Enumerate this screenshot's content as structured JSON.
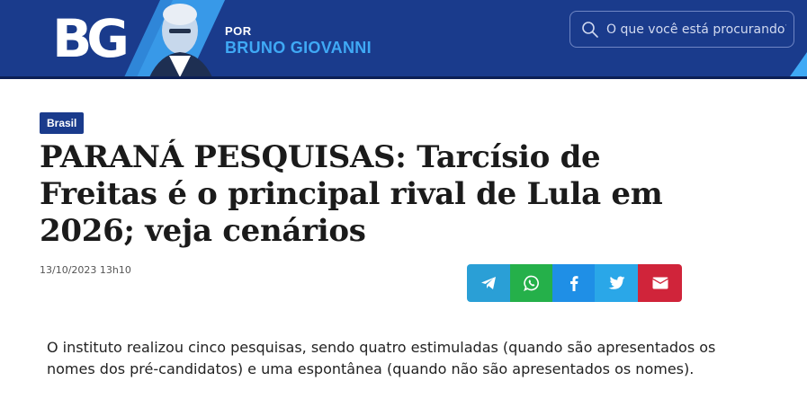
{
  "header": {
    "logo_text": "BG",
    "byline_prefix": "POR",
    "byline_name": "BRUNO GIOVANNI",
    "colors": {
      "background": "#1a3b8c",
      "accent": "#3fa9f5"
    }
  },
  "search": {
    "placeholder": "O que você está procurando?",
    "icon": "search-icon"
  },
  "article": {
    "category": "Brasil",
    "headline": "PARANÁ PESQUISAS: Tarcísio de Freitas é o principal rival de Lula em 2026; veja cenários",
    "timestamp": "13/10/2023 13h10",
    "body": "O instituto realizou cinco pesquisas, sendo quatro estimuladas (quando são apresentados os nomes dos pré-candidatos) e uma espontânea (quando não são apresentados os nomes)."
  },
  "share": {
    "buttons": [
      {
        "name": "telegram",
        "icon": "telegram-icon",
        "color": "#2a9fd6"
      },
      {
        "name": "whatsapp",
        "icon": "whatsapp-icon",
        "color": "#25b04a"
      },
      {
        "name": "facebook",
        "icon": "facebook-icon",
        "color": "#1f8fe6"
      },
      {
        "name": "twitter",
        "icon": "twitter-icon",
        "color": "#2aa7e8"
      },
      {
        "name": "email",
        "icon": "email-icon",
        "color": "#d0243a"
      }
    ]
  }
}
